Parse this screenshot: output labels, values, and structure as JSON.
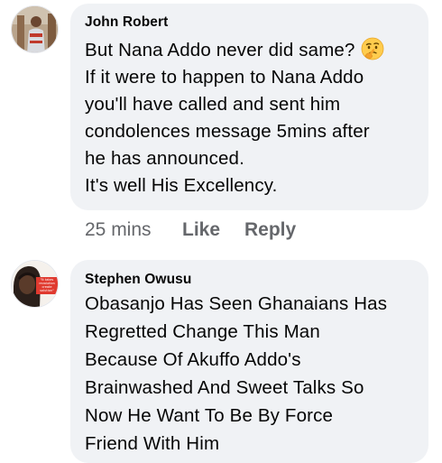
{
  "comments": [
    {
      "author": "John Robert",
      "lines": [
        "But Nana Addo never did same?",
        "If it were to happen to Nana Addo",
        "you'll have called and sent him",
        "condolences message 5mins after",
        "he has announced.",
        "It's well His Excellency."
      ],
      "emoji": "thinking-face-emoji",
      "time": "25 mins",
      "like_label": "Like",
      "reply_label": "Reply"
    },
    {
      "author": "Stephen Owusu",
      "lines": [
        "Obasanjo Has Seen Ghanaians Has",
        "Regretted Change This Man",
        "Because Of Akuffo Addo's",
        "Brainwashed And Sweet Talks So",
        "Now He Want To Be By Force",
        "Friend With Him"
      ],
      "avatar_badge_text": "\"It takes revolution create solution\""
    }
  ],
  "colors": {
    "bubble": "#f0f2f5",
    "text": "#050505",
    "meta": "#65676b",
    "badge_red": "#e03a2f"
  }
}
